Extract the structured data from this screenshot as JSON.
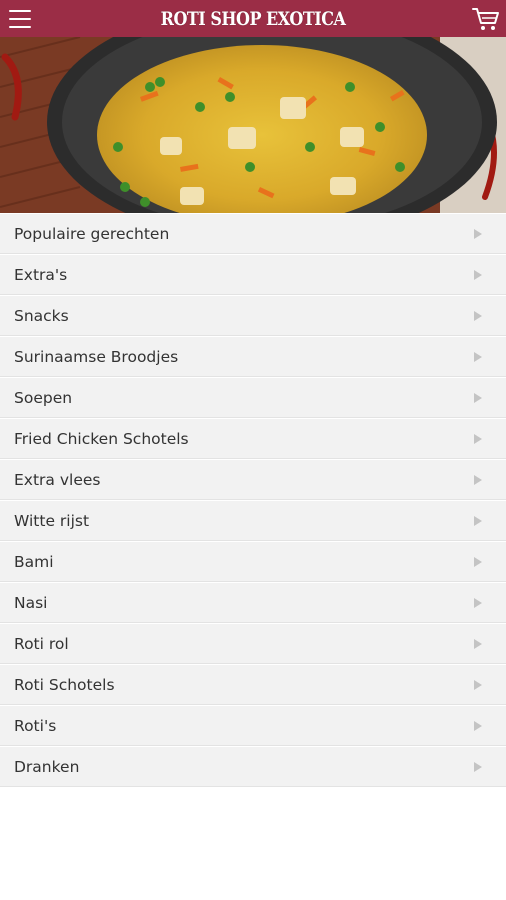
{
  "app": {
    "title": "ROTI SHOP EXOTICA",
    "accent_color": "#9b2d46"
  },
  "header": {
    "menu_icon": "hamburger-menu-icon",
    "cart_icon": "shopping-cart-icon"
  },
  "categories": [
    {
      "label": "Populaire gerechten"
    },
    {
      "label": "Extra's"
    },
    {
      "label": "Snacks"
    },
    {
      "label": "Surinaamse Broodjes"
    },
    {
      "label": "Soepen"
    },
    {
      "label": "Fried Chicken Schotels"
    },
    {
      "label": "Extra vlees"
    },
    {
      "label": "Witte rijst"
    },
    {
      "label": "Bami"
    },
    {
      "label": "Nasi"
    },
    {
      "label": "Roti rol"
    },
    {
      "label": "Roti Schotels"
    },
    {
      "label": "Roti's"
    },
    {
      "label": "Dranken"
    }
  ]
}
